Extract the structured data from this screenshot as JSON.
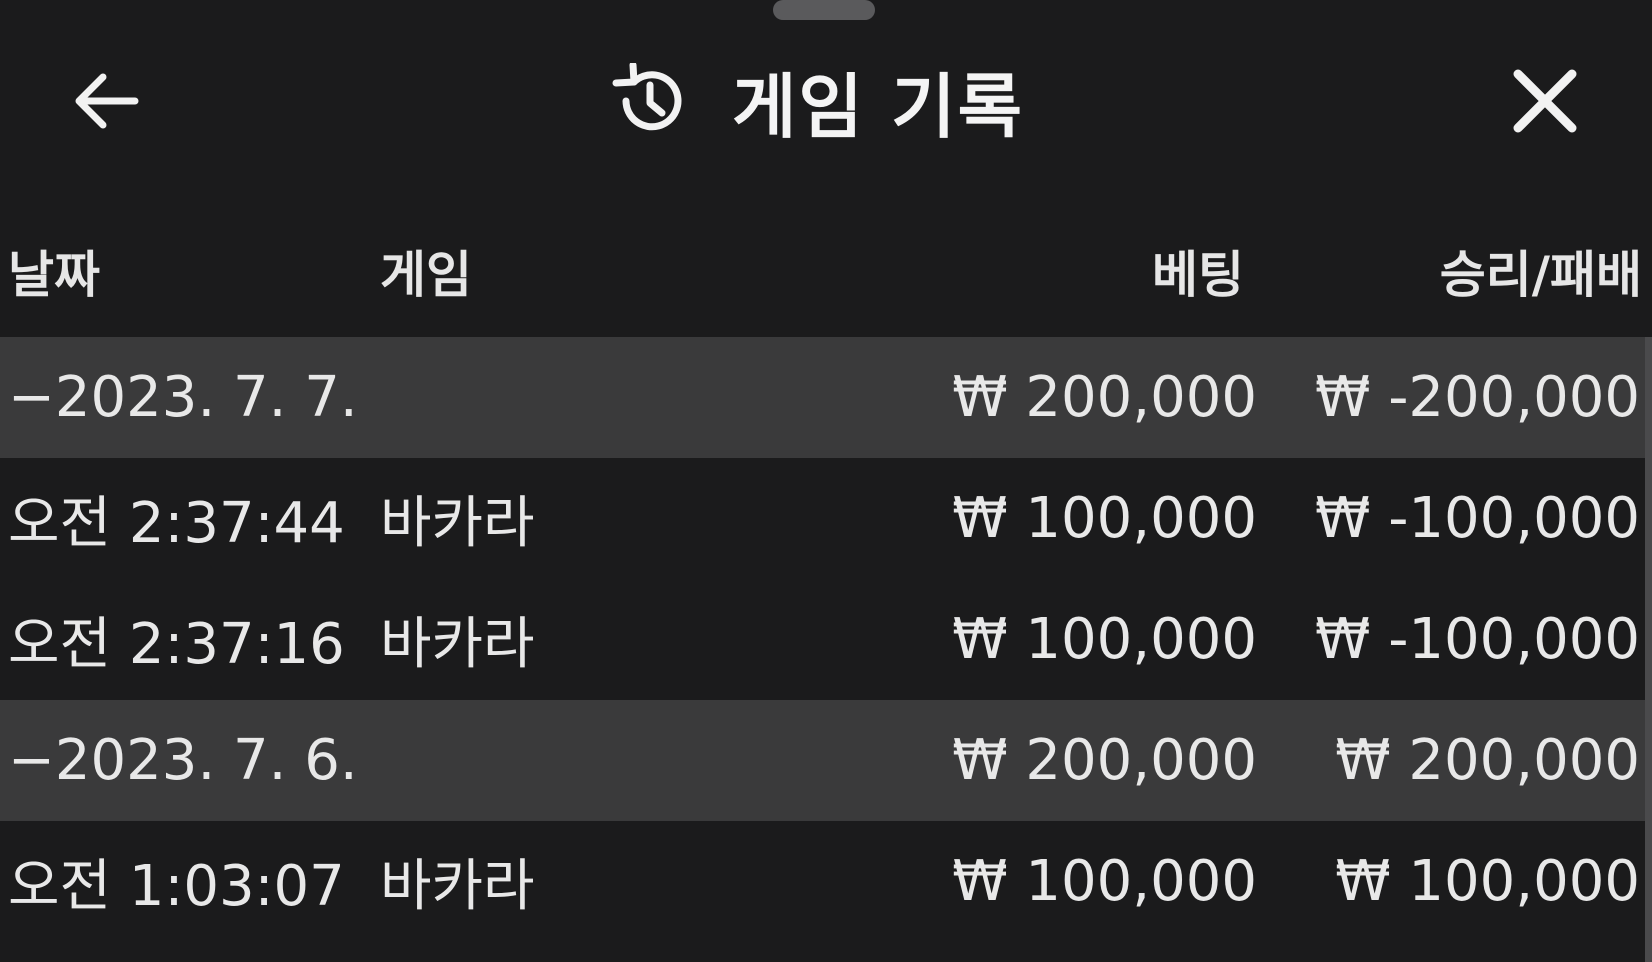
{
  "header": {
    "title": "게임 기록",
    "back_icon": "arrow-left-icon",
    "history_icon": "history-icon",
    "close_icon": "close-icon"
  },
  "columns": {
    "date": "날짜",
    "game": "게임",
    "bet": "베팅",
    "result": "승리/패배"
  },
  "rows": [
    {
      "type": "group",
      "date": "−2023. 7. 7.",
      "game": "",
      "bet": "₩ 200,000",
      "result": "₩ -200,000"
    },
    {
      "type": "item",
      "date": "오전 2:37:44",
      "game": "바카라",
      "bet": "₩ 100,000",
      "result": "₩ -100,000"
    },
    {
      "type": "item",
      "date": "오전 2:37:16",
      "game": "바카라",
      "bet": "₩ 100,000",
      "result": "₩ -100,000"
    },
    {
      "type": "group",
      "date": "−2023. 7. 6.",
      "game": "",
      "bet": "₩ 200,000",
      "result": "₩ 200,000"
    },
    {
      "type": "item",
      "date": "오전 1:03:07",
      "game": "바카라",
      "bet": "₩ 100,000",
      "result": "₩ 100,000"
    }
  ],
  "colors": {
    "background": "#1b1b1c",
    "group_row": "#3a3a3b",
    "text": "#e8e8e8"
  }
}
